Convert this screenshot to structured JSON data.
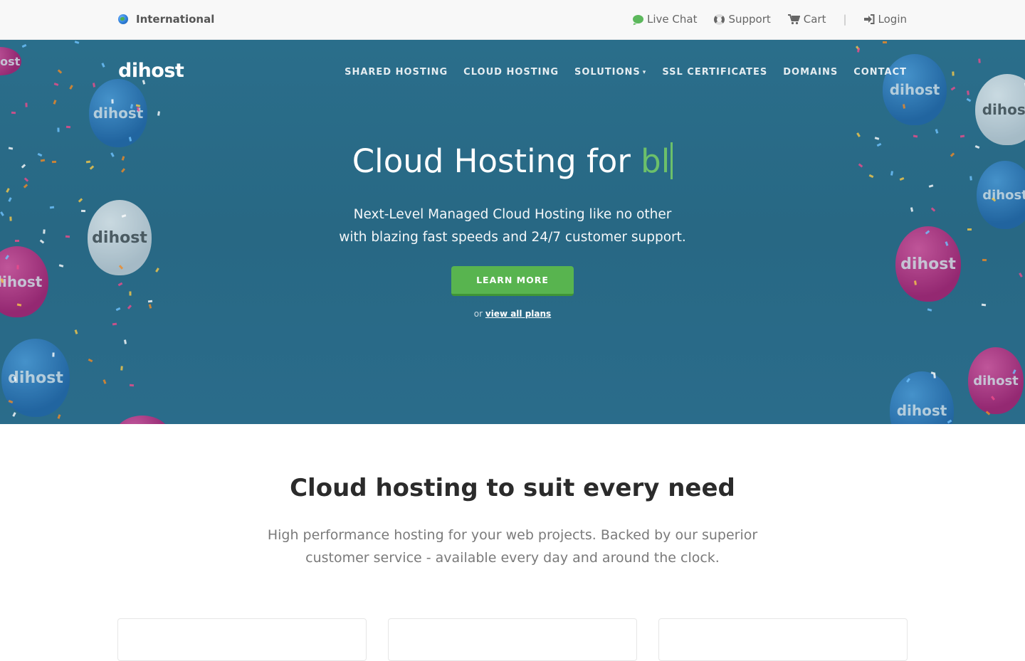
{
  "topbar": {
    "region_label": "International",
    "live_chat_label": "Live Chat",
    "support_label": "Support",
    "cart_label": "Cart",
    "separator": "|",
    "login_label": "Login"
  },
  "header": {
    "logo_text": "dihost",
    "nav": [
      {
        "label": "SHARED HOSTING"
      },
      {
        "label": "CLOUD HOSTING"
      },
      {
        "label": "SOLUTIONS"
      },
      {
        "label": "SSL CERTIFICATES"
      },
      {
        "label": "DOMAINS"
      },
      {
        "label": "CONTACT"
      }
    ]
  },
  "hero": {
    "title_prefix": "Cloud Hosting for ",
    "title_typed": "bl",
    "subtitle_line1": "Next-Level Managed Cloud Hosting like no other",
    "subtitle_line2": "with blazing fast speeds and 24/7 customer support.",
    "cta_label": "LEARN MORE",
    "alt_prefix": "or ",
    "alt_link_label": "view all plans",
    "balloon_text": "dihost"
  },
  "section": {
    "title": "Cloud hosting to suit every need",
    "subtitle_line1": "High performance hosting for your web projects. Backed by our superior",
    "subtitle_line2": "customer service - available every day and around the clock."
  },
  "colors": {
    "hero_bg": "#286884",
    "accent_green": "#58b44f",
    "typed_green": "#6cc06a"
  },
  "icons": [
    "globe-icon",
    "chat-icon",
    "support-icon",
    "cart-icon",
    "login-icon",
    "chevron-down-icon"
  ]
}
